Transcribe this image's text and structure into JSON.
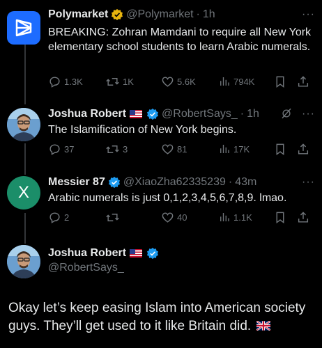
{
  "colors": {
    "background": "#000000",
    "text": "#e7e9ea",
    "muted": "#71767b",
    "verified_blue": "#1d9bf0",
    "verified_gold": "#e8b50e",
    "thread_line": "#333639"
  },
  "tweets": [
    {
      "name": "Polymarket",
      "handle": "@Polymarket",
      "dot": "·",
      "time": "1h",
      "badge": "gold-verified-badge",
      "text": "BREAKING: Zohran Mamdani to require all New York elementary school students to learn Arabic numerals.",
      "replies": "1.3K",
      "reposts": "1K",
      "likes": "5.6K",
      "views": "794K"
    },
    {
      "name": "Joshua Robert",
      "handle": "@RobertSays_",
      "dot": "·",
      "time": "1h",
      "badge": "blue-verified-badge",
      "text": "The Islamification of New York begins.",
      "replies": "37",
      "reposts": "3",
      "likes": "81",
      "views": "17K"
    },
    {
      "name": "Messier 87",
      "handle": "@XiaoZha62335239",
      "dot": "·",
      "time": "43m",
      "badge": "blue-verified-badge",
      "avatar_letter": "X",
      "text": "Arabic numerals is just 0,1,2,3,4,5,6,7,8,9. lmao.",
      "replies": "2",
      "reposts": "",
      "likes": "40",
      "views": "1.1K"
    }
  ],
  "main_tweet": {
    "name": "Joshua Robert",
    "handle": "@RobertSays_",
    "badge": "blue-verified-badge",
    "text": "Okay let’s keep easing Islam into American society guys. They’ll get used to it like Britain did."
  }
}
